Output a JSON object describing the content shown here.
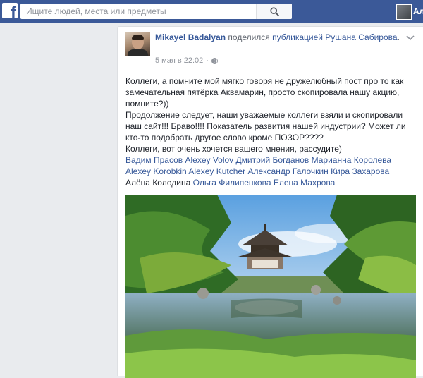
{
  "topbar": {
    "logo": "f",
    "search_placeholder": "Ищите людей, места или предметы",
    "user_name": "Ал",
    "icons": [
      "facebook-logo",
      "search-icon"
    ]
  },
  "post": {
    "author": "Mikayel Badalyan",
    "shared_text": "поделился",
    "link_prefix": "публикацией",
    "original_author": "Рушана Сабирова",
    "trailing_dot": ".",
    "time": "5 мая в 22:02",
    "separator": "·",
    "paragraphs": [
      "Коллеги, а помните мой мягко говоря не дружелюбный пост про то как замечательная пятёрка Аквамарин, просто скопировала нашу акцию, помните?))",
      "Продолжение следует, наши уважаемые коллеги взяли и скопировали наш сайт!!! Браво!!!! Показатель развития нашей индустрии? Может ли кто-то подобрать другое слово кроме ПОЗОР????",
      "Коллеги, вот очень хочется вашего мнения, рассудите)"
    ],
    "tags": [
      "Вадим Прасов",
      "Alexey Volov",
      "Дмитрий Богданов",
      "Марианна Королева",
      "Alexey Korobkin",
      "Alexey Kutcher",
      "Александр Галочкин",
      "Кира Захарова",
      "Алёна Колодина",
      "Ольга Филипенкова",
      "Елена Махрова"
    ],
    "image": "japanese-garden-pavilion-photo"
  },
  "colors": {
    "topbar": "#3b5998",
    "link": "#365899",
    "page_bg": "#e9ebee",
    "meta": "#90949c"
  }
}
